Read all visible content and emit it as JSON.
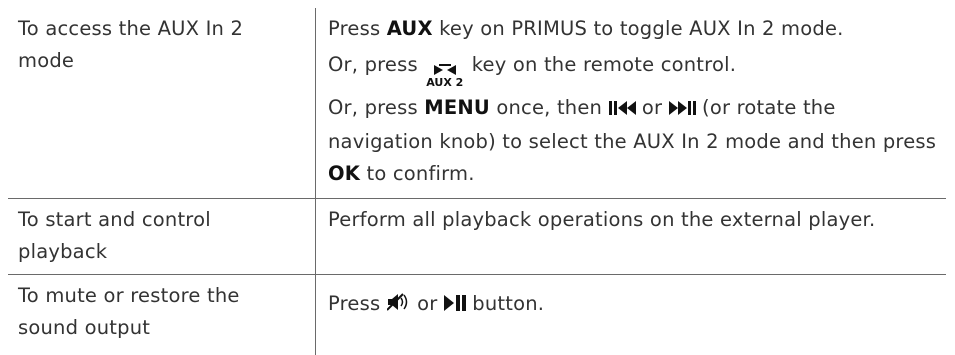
{
  "rows": [
    {
      "action": "To access the AUX In 2 mode",
      "lines": {
        "l1_pre": "Press ",
        "l1_key": "AUX",
        "l1_post": " key on PRIMUS to toggle AUX In 2 mode.",
        "l2_pre": "Or, press ",
        "l2_icon_label": "AUX 2",
        "l2_post": " key on the remote control.",
        "l3_pre": "Or, press ",
        "l3_key": "MENU",
        "l3_mid1": " once, then ",
        "l3_mid2": " or ",
        "l3_mid3": " (or rotate the navigation knob) to select the AUX In 2 mode and then press ",
        "l3_key2": "OK",
        "l3_post": " to confirm."
      }
    },
    {
      "action": "To start and control playback",
      "description": "Perform all playback operations on the external player."
    },
    {
      "action": "To mute or restore the sound output",
      "lines": {
        "pre": "Press ",
        "mid": " or ",
        "post": " button."
      }
    }
  ],
  "icons": {
    "prev": "pause-previous-icon",
    "next": "next-play-icon",
    "aux2": "aux2-swap-icon",
    "mute": "mute-speaker-icon",
    "playpause": "play-pause-icon"
  },
  "colors": {
    "text": "#333333",
    "key": "#111111",
    "border": "#6a6a6a"
  }
}
